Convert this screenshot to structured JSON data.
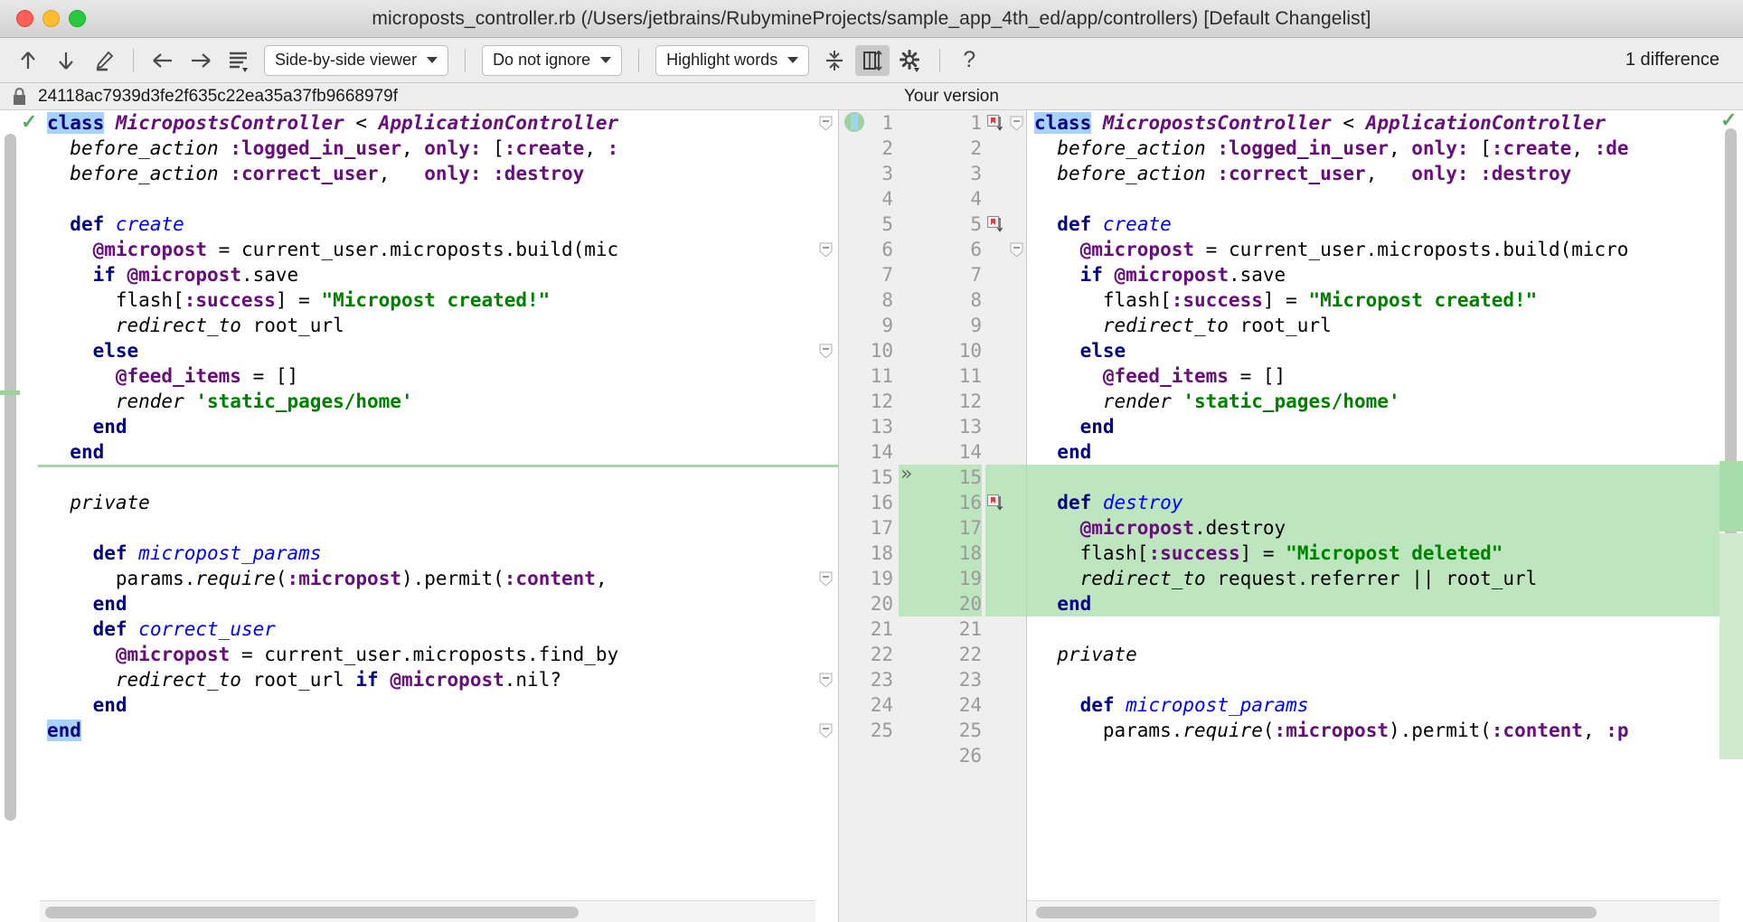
{
  "window": {
    "title": "microposts_controller.rb (/Users/jetbrains/RubymineProjects/sample_app_4th_ed/app/controllers) [Default Changelist]",
    "traffic_lights": [
      "close",
      "minimize",
      "maximize"
    ]
  },
  "toolbar": {
    "icons": [
      {
        "name": "previous-difference-icon",
        "glyph": "↑"
      },
      {
        "name": "next-difference-icon",
        "glyph": "↓"
      },
      {
        "name": "edit-icon",
        "glyph": "✎"
      },
      {
        "name": "accept-left-icon",
        "glyph": "←"
      },
      {
        "name": "accept-right-icon",
        "glyph": "→"
      },
      {
        "name": "menu-icon",
        "glyph": "☰"
      }
    ],
    "viewer_mode": "Side-by-side viewer",
    "ignore_mode": "Do not ignore",
    "highlight_mode": "Highlight words",
    "collapse_label": "collapse-unchanged-icon",
    "sync_label": "synchronize-scroll-icon",
    "settings_label": "settings-icon",
    "help_label": "?",
    "difference_count": "1 difference"
  },
  "revision_header": {
    "left_label": "24118ac7939d3fe2f635c22ea35a37fb9668979f",
    "right_label": "Your version",
    "lock_icon": "lock-icon"
  },
  "left_pane": {
    "lines": [
      {
        "n": 1,
        "tokens": [
          {
            "t": "class",
            "c": "kw sel"
          },
          {
            "t": " ",
            "c": "plain"
          },
          {
            "t": "MicropostsController",
            "c": "cls"
          },
          {
            "t": " < ",
            "c": "plain"
          },
          {
            "t": "ApplicationController",
            "c": "cls"
          }
        ]
      },
      {
        "n": 2,
        "tokens": [
          {
            "t": "  ",
            "c": "plain"
          },
          {
            "t": "before_action",
            "c": "idi"
          },
          {
            "t": " ",
            "c": "plain"
          },
          {
            "t": ":logged_in_user",
            "c": "sym"
          },
          {
            "t": ", ",
            "c": "plain"
          },
          {
            "t": "only:",
            "c": "sym"
          },
          {
            "t": " [",
            "c": "plain"
          },
          {
            "t": ":create",
            "c": "sym"
          },
          {
            "t": ", ",
            "c": "plain"
          },
          {
            "t": ":",
            "c": "sym"
          }
        ]
      },
      {
        "n": 3,
        "tokens": [
          {
            "t": "  ",
            "c": "plain"
          },
          {
            "t": "before_action",
            "c": "idi"
          },
          {
            "t": " ",
            "c": "plain"
          },
          {
            "t": ":correct_user",
            "c": "sym"
          },
          {
            "t": ",   ",
            "c": "plain"
          },
          {
            "t": "only:",
            "c": "sym"
          },
          {
            "t": " ",
            "c": "plain"
          },
          {
            "t": ":destroy",
            "c": "sym"
          }
        ]
      },
      {
        "n": 4,
        "tokens": []
      },
      {
        "n": 5,
        "tokens": [
          {
            "t": "  ",
            "c": "plain"
          },
          {
            "t": "def",
            "c": "kw"
          },
          {
            "t": " ",
            "c": "plain"
          },
          {
            "t": "create",
            "c": "mth"
          }
        ]
      },
      {
        "n": 6,
        "tokens": [
          {
            "t": "    ",
            "c": "plain"
          },
          {
            "t": "@micropost",
            "c": "ivar"
          },
          {
            "t": " = current_user.microposts.build(mic",
            "c": "plain"
          }
        ]
      },
      {
        "n": 7,
        "tokens": [
          {
            "t": "    ",
            "c": "plain"
          },
          {
            "t": "if",
            "c": "kw"
          },
          {
            "t": " ",
            "c": "plain"
          },
          {
            "t": "@micropost",
            "c": "ivar"
          },
          {
            "t": ".save",
            "c": "plain"
          }
        ]
      },
      {
        "n": 8,
        "tokens": [
          {
            "t": "      flash[",
            "c": "plain"
          },
          {
            "t": ":success",
            "c": "sym"
          },
          {
            "t": "] = ",
            "c": "plain"
          },
          {
            "t": "\"Micropost created!\"",
            "c": "str"
          }
        ]
      },
      {
        "n": 9,
        "tokens": [
          {
            "t": "      ",
            "c": "plain"
          },
          {
            "t": "redirect_to",
            "c": "idi"
          },
          {
            "t": " root_url",
            "c": "plain"
          }
        ]
      },
      {
        "n": 10,
        "tokens": [
          {
            "t": "    ",
            "c": "plain"
          },
          {
            "t": "else",
            "c": "kw"
          }
        ]
      },
      {
        "n": 11,
        "tokens": [
          {
            "t": "      ",
            "c": "plain"
          },
          {
            "t": "@feed_items",
            "c": "ivar"
          },
          {
            "t": " = []",
            "c": "plain"
          }
        ]
      },
      {
        "n": 12,
        "tokens": [
          {
            "t": "      ",
            "c": "plain"
          },
          {
            "t": "render",
            "c": "idi"
          },
          {
            "t": " ",
            "c": "plain"
          },
          {
            "t": "'static_pages/home'",
            "c": "str"
          }
        ]
      },
      {
        "n": 13,
        "tokens": [
          {
            "t": "    ",
            "c": "plain"
          },
          {
            "t": "end",
            "c": "kw"
          }
        ]
      },
      {
        "n": 14,
        "tokens": [
          {
            "t": "  ",
            "c": "plain"
          },
          {
            "t": "end",
            "c": "kw"
          }
        ]
      },
      {
        "n": 15,
        "tokens": []
      },
      {
        "n": 16,
        "tokens": [
          {
            "t": "  ",
            "c": "plain"
          },
          {
            "t": "private",
            "c": "idi"
          }
        ]
      },
      {
        "n": 17,
        "tokens": []
      },
      {
        "n": 18,
        "tokens": [
          {
            "t": "    ",
            "c": "plain"
          },
          {
            "t": "def",
            "c": "kw"
          },
          {
            "t": " ",
            "c": "plain"
          },
          {
            "t": "micropost_params",
            "c": "mth"
          }
        ]
      },
      {
        "n": 19,
        "tokens": [
          {
            "t": "      params.",
            "c": "plain"
          },
          {
            "t": "require",
            "c": "idi"
          },
          {
            "t": "(",
            "c": "plain"
          },
          {
            "t": ":micropost",
            "c": "sym"
          },
          {
            "t": ").permit(",
            "c": "plain"
          },
          {
            "t": ":content",
            "c": "sym"
          },
          {
            "t": ",",
            "c": "plain"
          }
        ]
      },
      {
        "n": 20,
        "tokens": [
          {
            "t": "    ",
            "c": "plain"
          },
          {
            "t": "end",
            "c": "kw"
          }
        ]
      },
      {
        "n": 21,
        "tokens": [
          {
            "t": "    ",
            "c": "plain"
          },
          {
            "t": "def",
            "c": "kw"
          },
          {
            "t": " ",
            "c": "plain"
          },
          {
            "t": "correct_user",
            "c": "mth"
          }
        ]
      },
      {
        "n": 22,
        "tokens": [
          {
            "t": "      ",
            "c": "plain"
          },
          {
            "t": "@micropost",
            "c": "ivar"
          },
          {
            "t": " = current_user.microposts.find_by",
            "c": "plain"
          }
        ]
      },
      {
        "n": 23,
        "tokens": [
          {
            "t": "      ",
            "c": "plain"
          },
          {
            "t": "redirect_to",
            "c": "idi"
          },
          {
            "t": " root_url ",
            "c": "plain"
          },
          {
            "t": "if",
            "c": "kw"
          },
          {
            "t": " ",
            "c": "plain"
          },
          {
            "t": "@micropost",
            "c": "ivar"
          },
          {
            "t": ".nil?",
            "c": "plain"
          }
        ]
      },
      {
        "n": 24,
        "tokens": [
          {
            "t": "    ",
            "c": "plain"
          },
          {
            "t": "end",
            "c": "kw"
          }
        ]
      },
      {
        "n": 25,
        "tokens": [
          {
            "t": "end",
            "c": "kw sel"
          }
        ]
      }
    ],
    "line_numbers": [
      1,
      2,
      3,
      4,
      5,
      6,
      7,
      8,
      9,
      10,
      11,
      12,
      13,
      14,
      15,
      16,
      17,
      18,
      19,
      20,
      21,
      22,
      23,
      24,
      25
    ],
    "status_icon": "checkmark-icon"
  },
  "right_pane": {
    "lines": [
      {
        "n": 1,
        "added": false,
        "tokens": [
          {
            "t": "class",
            "c": "kw sel"
          },
          {
            "t": " ",
            "c": "plain"
          },
          {
            "t": "MicropostsController",
            "c": "cls"
          },
          {
            "t": " < ",
            "c": "plain"
          },
          {
            "t": "ApplicationController",
            "c": "cls"
          }
        ]
      },
      {
        "n": 2,
        "added": false,
        "tokens": [
          {
            "t": "  ",
            "c": "plain"
          },
          {
            "t": "before_action",
            "c": "idi"
          },
          {
            "t": " ",
            "c": "plain"
          },
          {
            "t": ":logged_in_user",
            "c": "sym"
          },
          {
            "t": ", ",
            "c": "plain"
          },
          {
            "t": "only:",
            "c": "sym"
          },
          {
            "t": " [",
            "c": "plain"
          },
          {
            "t": ":create",
            "c": "sym"
          },
          {
            "t": ", ",
            "c": "plain"
          },
          {
            "t": ":de",
            "c": "sym"
          }
        ]
      },
      {
        "n": 3,
        "added": false,
        "tokens": [
          {
            "t": "  ",
            "c": "plain"
          },
          {
            "t": "before_action",
            "c": "idi"
          },
          {
            "t": " ",
            "c": "plain"
          },
          {
            "t": ":correct_user",
            "c": "sym"
          },
          {
            "t": ",   ",
            "c": "plain"
          },
          {
            "t": "only:",
            "c": "sym"
          },
          {
            "t": " ",
            "c": "plain"
          },
          {
            "t": ":destroy",
            "c": "sym"
          }
        ]
      },
      {
        "n": 4,
        "added": false,
        "tokens": []
      },
      {
        "n": 5,
        "added": false,
        "tokens": [
          {
            "t": "  ",
            "c": "plain"
          },
          {
            "t": "def",
            "c": "kw"
          },
          {
            "t": " ",
            "c": "plain"
          },
          {
            "t": "create",
            "c": "mth"
          }
        ]
      },
      {
        "n": 6,
        "added": false,
        "tokens": [
          {
            "t": "    ",
            "c": "plain"
          },
          {
            "t": "@micropost",
            "c": "ivar"
          },
          {
            "t": " = current_user.microposts.build(micro",
            "c": "plain"
          }
        ]
      },
      {
        "n": 7,
        "added": false,
        "tokens": [
          {
            "t": "    ",
            "c": "plain"
          },
          {
            "t": "if",
            "c": "kw"
          },
          {
            "t": " ",
            "c": "plain"
          },
          {
            "t": "@micropost",
            "c": "ivar"
          },
          {
            "t": ".save",
            "c": "plain"
          }
        ]
      },
      {
        "n": 8,
        "added": false,
        "tokens": [
          {
            "t": "      flash[",
            "c": "plain"
          },
          {
            "t": ":success",
            "c": "sym"
          },
          {
            "t": "] = ",
            "c": "plain"
          },
          {
            "t": "\"Micropost created!\"",
            "c": "str"
          }
        ]
      },
      {
        "n": 9,
        "added": false,
        "tokens": [
          {
            "t": "      ",
            "c": "plain"
          },
          {
            "t": "redirect_to",
            "c": "idi"
          },
          {
            "t": " root_url",
            "c": "plain"
          }
        ]
      },
      {
        "n": 10,
        "added": false,
        "tokens": [
          {
            "t": "    ",
            "c": "plain"
          },
          {
            "t": "else",
            "c": "kw"
          }
        ]
      },
      {
        "n": 11,
        "added": false,
        "tokens": [
          {
            "t": "      ",
            "c": "plain"
          },
          {
            "t": "@feed_items",
            "c": "ivar"
          },
          {
            "t": " = []",
            "c": "plain"
          }
        ]
      },
      {
        "n": 12,
        "added": false,
        "tokens": [
          {
            "t": "      ",
            "c": "plain"
          },
          {
            "t": "render",
            "c": "idi"
          },
          {
            "t": " ",
            "c": "plain"
          },
          {
            "t": "'static_pages/home'",
            "c": "str"
          }
        ]
      },
      {
        "n": 13,
        "added": false,
        "tokens": [
          {
            "t": "    ",
            "c": "plain"
          },
          {
            "t": "end",
            "c": "kw"
          }
        ]
      },
      {
        "n": 14,
        "added": false,
        "tokens": [
          {
            "t": "  ",
            "c": "plain"
          },
          {
            "t": "end",
            "c": "kw"
          }
        ]
      },
      {
        "n": 15,
        "added": true,
        "tokens": []
      },
      {
        "n": 16,
        "added": true,
        "tokens": [
          {
            "t": "  ",
            "c": "plain"
          },
          {
            "t": "def",
            "c": "kw"
          },
          {
            "t": " ",
            "c": "plain"
          },
          {
            "t": "destroy",
            "c": "mth"
          }
        ]
      },
      {
        "n": 17,
        "added": true,
        "tokens": [
          {
            "t": "    ",
            "c": "plain"
          },
          {
            "t": "@micropost",
            "c": "ivar"
          },
          {
            "t": ".destroy",
            "c": "plain"
          }
        ]
      },
      {
        "n": 18,
        "added": true,
        "tokens": [
          {
            "t": "    flash[",
            "c": "plain"
          },
          {
            "t": ":success",
            "c": "sym"
          },
          {
            "t": "] = ",
            "c": "plain"
          },
          {
            "t": "\"Micropost deleted\"",
            "c": "str"
          }
        ]
      },
      {
        "n": 19,
        "added": true,
        "tokens": [
          {
            "t": "    ",
            "c": "plain"
          },
          {
            "t": "redirect_to",
            "c": "idi"
          },
          {
            "t": " request.referrer || root_url",
            "c": "plain"
          }
        ]
      },
      {
        "n": 20,
        "added": true,
        "tokens": [
          {
            "t": "  ",
            "c": "plain"
          },
          {
            "t": "end",
            "c": "kw"
          }
        ]
      },
      {
        "n": 21,
        "added": false,
        "tokens": []
      },
      {
        "n": 22,
        "added": false,
        "tokens": [
          {
            "t": "  ",
            "c": "plain"
          },
          {
            "t": "private",
            "c": "idi"
          }
        ]
      },
      {
        "n": 23,
        "added": false,
        "tokens": []
      },
      {
        "n": 24,
        "added": false,
        "tokens": [
          {
            "t": "    ",
            "c": "plain"
          },
          {
            "t": "def",
            "c": "kw"
          },
          {
            "t": " ",
            "c": "plain"
          },
          {
            "t": "micropost_params",
            "c": "mth"
          }
        ]
      },
      {
        "n": 25,
        "added": false,
        "tokens": [
          {
            "t": "      params.",
            "c": "plain"
          },
          {
            "t": "require",
            "c": "idi"
          },
          {
            "t": "(",
            "c": "plain"
          },
          {
            "t": ":micropost",
            "c": "sym"
          },
          {
            "t": ").permit(",
            "c": "plain"
          },
          {
            "t": ":content",
            "c": "sym"
          },
          {
            "t": ", ",
            "c": "plain"
          },
          {
            "t": ":p",
            "c": "sym"
          }
        ]
      },
      {
        "n": 26,
        "added": false,
        "tokens": []
      }
    ],
    "old_line_numbers": [
      1,
      2,
      3,
      4,
      5,
      6,
      7,
      8,
      9,
      10,
      11,
      12,
      13,
      14,
      15,
      16,
      17,
      18,
      19,
      20,
      21,
      22,
      23,
      24,
      25
    ],
    "new_line_numbers": [
      1,
      2,
      3,
      4,
      5,
      6,
      7,
      8,
      9,
      10,
      11,
      12,
      13,
      14,
      15,
      16,
      17,
      18,
      19,
      20,
      21,
      22,
      23,
      24,
      25,
      26
    ],
    "status_icon": "checkmark-icon",
    "chevron_icon": "accept-change-chevron-icon",
    "bookmark_lines": [
      1,
      5,
      16
    ]
  },
  "colors": {
    "added_bg": "#bee6be",
    "selection": "#a6d2ff",
    "keyword": "#000080",
    "class": "#660e7a",
    "method": "#0000ff",
    "string": "#008000",
    "gutter_bg": "#efefef",
    "ok_green": "#59a869"
  }
}
